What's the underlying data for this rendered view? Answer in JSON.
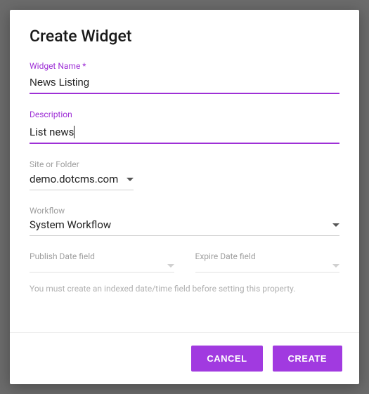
{
  "dialog": {
    "title": "Create Widget"
  },
  "fields": {
    "widgetName": {
      "label": "Widget Name *",
      "value": "News Listing"
    },
    "description": {
      "label": "Description",
      "value": "List news"
    },
    "siteOrFolder": {
      "label": "Site or Folder",
      "value": "demo.dotcms.com"
    },
    "workflow": {
      "label": "Workflow",
      "value": "System Workflow"
    },
    "publishDate": {
      "label": "Publish Date field",
      "value": ""
    },
    "expireDate": {
      "label": "Expire Date field",
      "value": ""
    }
  },
  "hint": "You must create an indexed date/time field before setting this property.",
  "actions": {
    "cancel": "Cancel",
    "create": "Create"
  }
}
